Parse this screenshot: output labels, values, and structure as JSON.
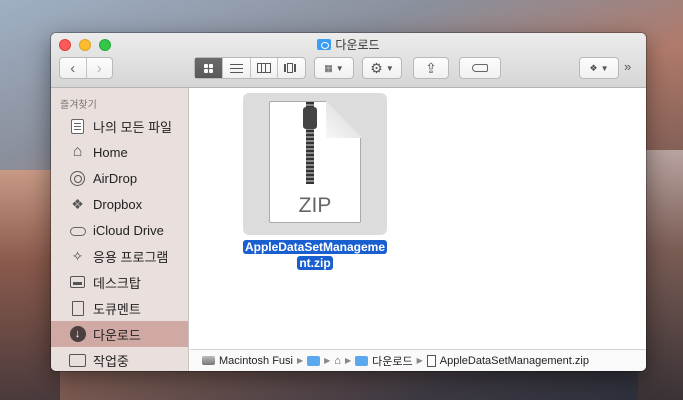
{
  "window": {
    "title": "다운로드"
  },
  "toolbar": {
    "back_icon": "chevron-left-icon",
    "forward_icon": "chevron-right-icon",
    "views": [
      "icon-view",
      "list-view",
      "column-view",
      "cover-flow-view"
    ],
    "active_view": "icon-view",
    "arrange_icon": "arrange-icon",
    "action_icon": "gear-icon",
    "share_icon": "share-icon",
    "tag_icon": "tag-icon",
    "dropbox_icon": "dropbox-icon",
    "more": "»"
  },
  "sidebar": {
    "header": "즐겨찾기",
    "items": [
      {
        "label": "나의 모든 파일",
        "icon": "all-files-icon"
      },
      {
        "label": "Home",
        "icon": "home-icon"
      },
      {
        "label": "AirDrop",
        "icon": "airdrop-icon"
      },
      {
        "label": "Dropbox",
        "icon": "dropbox-icon"
      },
      {
        "label": "iCloud Drive",
        "icon": "cloud-icon"
      },
      {
        "label": "응용 프로그램",
        "icon": "applications-icon"
      },
      {
        "label": "데스크탑",
        "icon": "desktop-icon"
      },
      {
        "label": "도큐멘트",
        "icon": "documents-icon"
      },
      {
        "label": "다운로드",
        "icon": "downloads-icon",
        "selected": true
      },
      {
        "label": "작업중",
        "icon": "folder-icon"
      }
    ]
  },
  "content": {
    "file": {
      "type_label": "ZIP",
      "name_line1": "AppleDataSetManageme",
      "name_line2": "nt.zip"
    }
  },
  "pathbar": {
    "items": [
      "Macintosh Fusi",
      "",
      "",
      "다운로드",
      "AppleDataSetManagement.zip"
    ]
  },
  "colors": {
    "selection": "#1a5fd0",
    "sidebar_selected": "#d0a9a4",
    "close": "#fc5b57",
    "minimize": "#fdbc2f",
    "maximize": "#33c748"
  }
}
